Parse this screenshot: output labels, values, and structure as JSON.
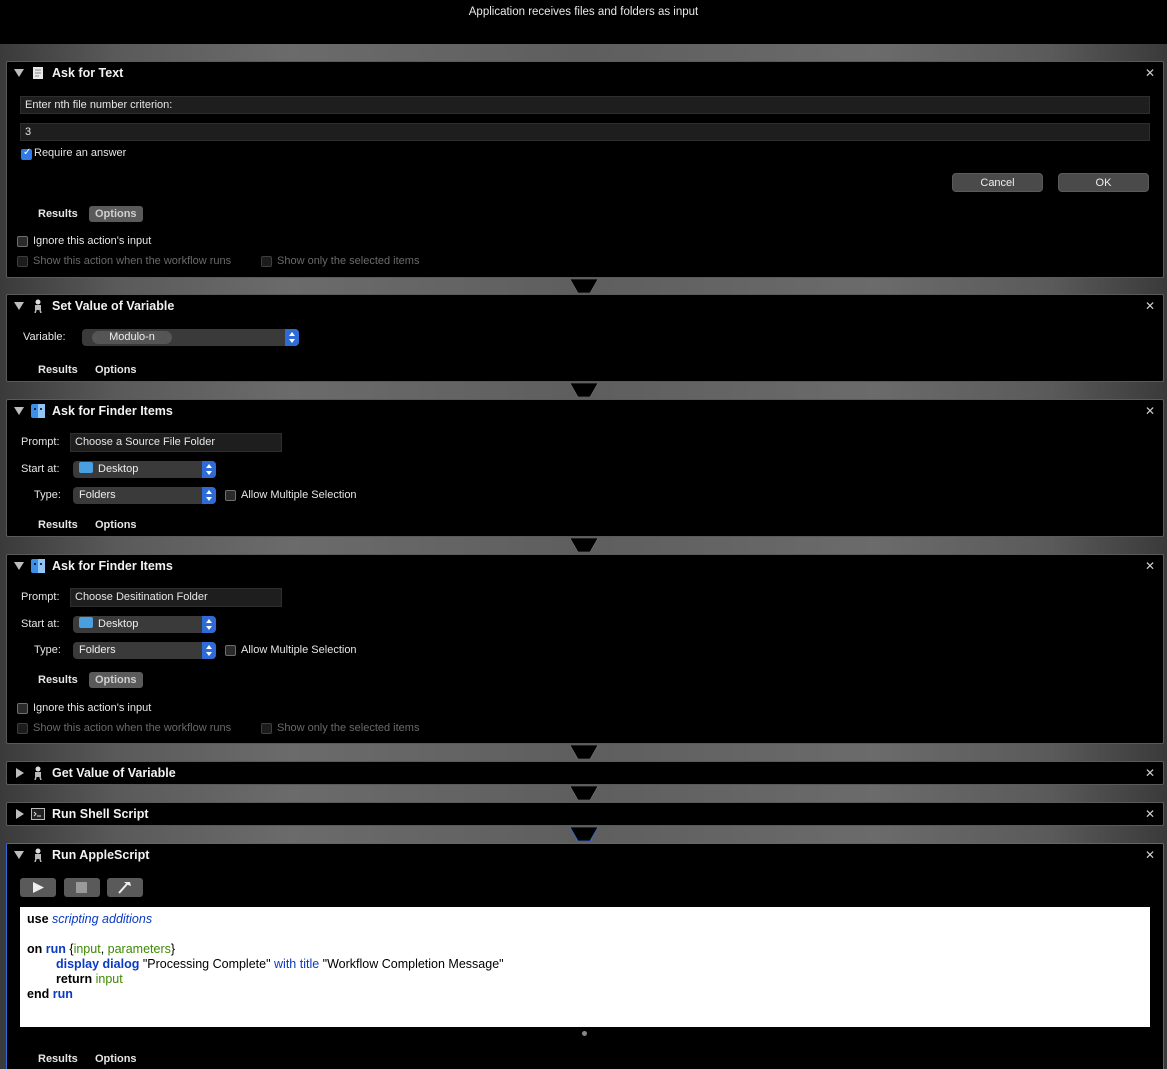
{
  "header": {
    "title": "Application receives files and folders as input"
  },
  "actions": [
    {
      "title": "Ask for Text",
      "question": "Enter nth file number criterion:",
      "default_answer": "3",
      "require_answer_label": "Require an answer",
      "cancel_label": "Cancel",
      "ok_label": "OK",
      "tab_results": "Results",
      "tab_options": "Options",
      "ignore_input_label": "Ignore this action's input",
      "show_action_label": "Show this action when the workflow runs",
      "show_selected_label": "Show only the selected items"
    },
    {
      "title": "Set Value of Variable",
      "variable_label": "Variable:",
      "variable_value": "Modulo-n",
      "tab_results": "Results",
      "tab_options": "Options"
    },
    {
      "title": "Ask for Finder Items",
      "prompt_label": "Prompt:",
      "prompt_value": "Choose a Source File Folder",
      "start_at_label": "Start at:",
      "start_at_value": "Desktop",
      "type_label": "Type:",
      "type_value": "Folders",
      "allow_multiple_label": "Allow Multiple Selection",
      "tab_results": "Results",
      "tab_options": "Options"
    },
    {
      "title": "Ask for Finder Items",
      "prompt_label": "Prompt:",
      "prompt_value": "Choose Desitination Folder",
      "start_at_label": "Start at:",
      "start_at_value": "Desktop",
      "type_label": "Type:",
      "type_value": "Folders",
      "allow_multiple_label": "Allow Multiple Selection",
      "tab_results": "Results",
      "tab_options": "Options",
      "ignore_input_label": "Ignore this action's input",
      "show_action_label": "Show this action when the workflow runs",
      "show_selected_label": "Show only the selected items"
    },
    {
      "title": "Get Value of Variable"
    },
    {
      "title": "Run Shell Script"
    },
    {
      "title": "Run AppleScript",
      "tab_results": "Results",
      "tab_options": "Options",
      "code": {
        "l1_use": "use",
        "l1_sa": "scripting additions",
        "l3_on": "on",
        "l3_run": "run",
        "l3_open": "{",
        "l3_input": "input",
        "l3_comma": ", ",
        "l3_params": "parameters",
        "l3_close": "}",
        "l4_dd": "display dialog",
        "l4_str1": "\"Processing Complete\"",
        "l4_wt": "with title",
        "l4_str2": "\"Workflow Completion Message\"",
        "l5_return": "return",
        "l5_input": "input",
        "l6_end": "end",
        "l6_run": "run"
      }
    }
  ],
  "icons": {
    "ask_text": "text-document-icon",
    "variable": "robot-automator-icon",
    "finder": "finder-icon",
    "terminal": "terminal-icon",
    "run": "play-icon",
    "stop": "stop-icon",
    "compile": "hammer-icon"
  },
  "colors": {
    "accent": "#2f6bd6",
    "keyword_blue": "#0a39c4",
    "variable_green": "#3d8a00"
  }
}
